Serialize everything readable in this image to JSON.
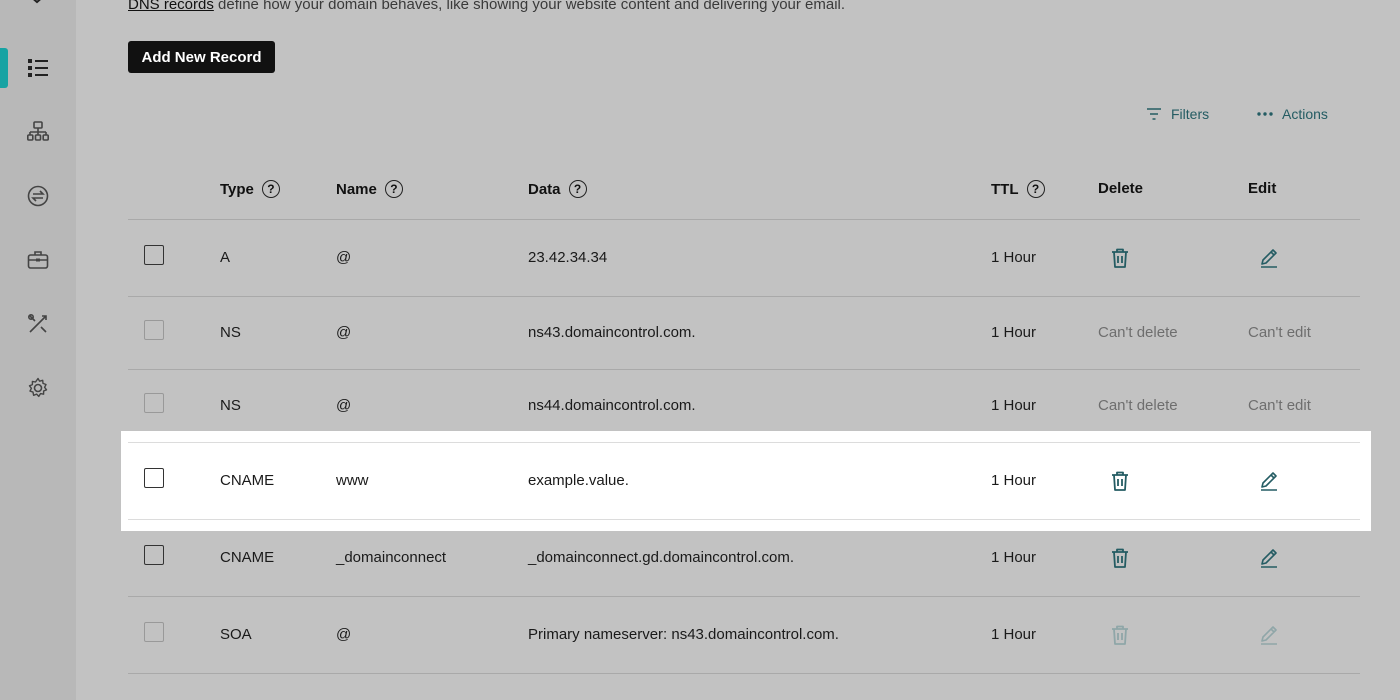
{
  "intro": {
    "link": "DNS records",
    "text": " define how your domain behaves, like showing your website content and delivering your email."
  },
  "buttons": {
    "add_record": "Add New Record",
    "filters": "Filters",
    "actions": "Actions"
  },
  "table": {
    "headers": {
      "type": "Type",
      "name": "Name",
      "data": "Data",
      "ttl": "TTL",
      "delete": "Delete",
      "edit": "Edit"
    },
    "help_glyph": "?",
    "rows": [
      {
        "type": "A",
        "name": "@",
        "data": "23.42.34.34",
        "ttl": "1 Hour",
        "delete": "",
        "edit": ""
      },
      {
        "type": "NS",
        "name": "@",
        "data": "ns43.domaincontrol.com.",
        "ttl": "1 Hour",
        "delete": "Can't delete",
        "edit": "Can't edit"
      },
      {
        "type": "NS",
        "name": "@",
        "data": "ns44.domaincontrol.com.",
        "ttl": "1 Hour",
        "delete": "Can't delete",
        "edit": "Can't edit"
      },
      {
        "type": "CNAME",
        "name": "www",
        "data": "example.value.",
        "ttl": "1 Hour",
        "delete": "",
        "edit": ""
      },
      {
        "type": "CNAME",
        "name": "_domainconnect",
        "data": "_domainconnect.gd.domaincontrol.com.",
        "ttl": "1 Hour",
        "delete": "",
        "edit": ""
      },
      {
        "type": "SOA",
        "name": "@",
        "data": "Primary nameserver: ns43.domaincontrol.com.",
        "ttl": "1 Hour",
        "delete": "",
        "edit": ""
      }
    ]
  },
  "colors": {
    "accent": "#17a3a3",
    "icon": "#245c63",
    "button_bg": "#111111"
  },
  "sidebar_icons": [
    "list-icon",
    "sitemap-icon",
    "transfer-icon",
    "briefcase-icon",
    "tools-icon",
    "gear-icon"
  ]
}
